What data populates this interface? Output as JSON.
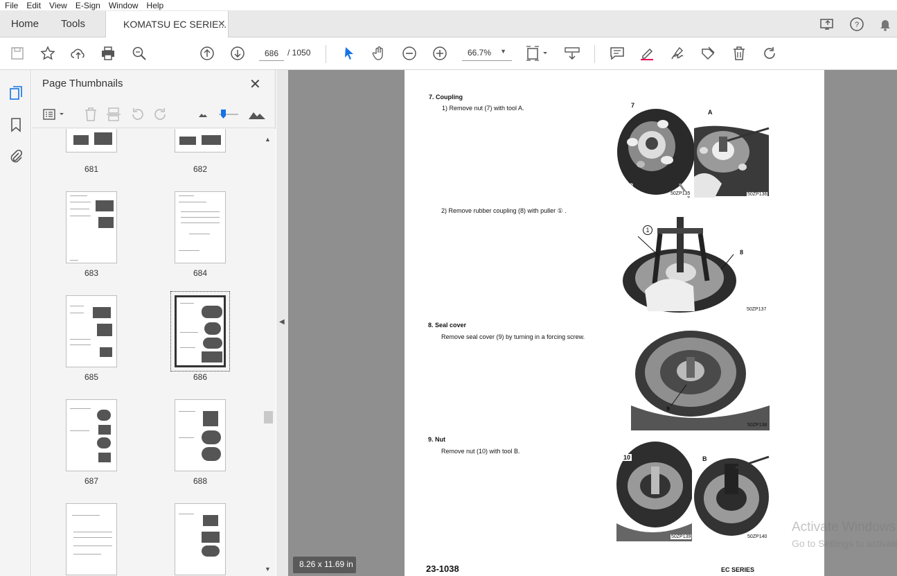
{
  "menu": [
    "File",
    "Edit",
    "View",
    "E-Sign",
    "Window",
    "Help"
  ],
  "tabs": {
    "home": "Home",
    "tools": "Tools",
    "document": "KOMATSU EC SERIE...",
    "close": "✕"
  },
  "toolbar": {
    "current_page": "686",
    "page_total": "/ 1050",
    "zoom": "66.7%"
  },
  "panel": {
    "title": "Page Thumbnails",
    "close": "✕",
    "thumbnails": [
      "681",
      "682",
      "683",
      "684",
      "685",
      "686",
      "687",
      "688",
      "",
      ""
    ],
    "selected": "686"
  },
  "document": {
    "sections": {
      "s7_title": "7.   Coupling",
      "s7_step1": "1)    Remove nut (7) with tool A.",
      "s7_step2": "2)    Remove rubber coupling (8) with puller ①  .",
      "s8_title": "8.   Seal cover",
      "s8_step": "Remove  seal  cover  (9)  by  turning  in  a  forcing screw.",
      "s9_title": "9.   Nut",
      "s9_step": "Remove nut (10) with tool B."
    },
    "photos": {
      "p135": "50ZP135",
      "p136": "50ZP136",
      "p137": "50ZP137",
      "p138": "50ZP138",
      "p139": "50ZP139",
      "p140": "50ZP140"
    },
    "callouts": {
      "c7": "7",
      "cA": "A",
      "c8a": "8",
      "c1": "1",
      "c8b": "8",
      "c9": "9",
      "c10": "10",
      "cB": "B"
    },
    "footer_left": "23-1038",
    "footer_right": "EC SERIES"
  },
  "page_size": "8.26 x 11.69 in",
  "watermark": {
    "line1": "Activate Windows",
    "line2": "Go to Settings to activate Windows."
  },
  "colors": {
    "tab_bg": "#e9e9e9",
    "doc_bg": "#8f8f8f",
    "accent": "#1473e6"
  }
}
